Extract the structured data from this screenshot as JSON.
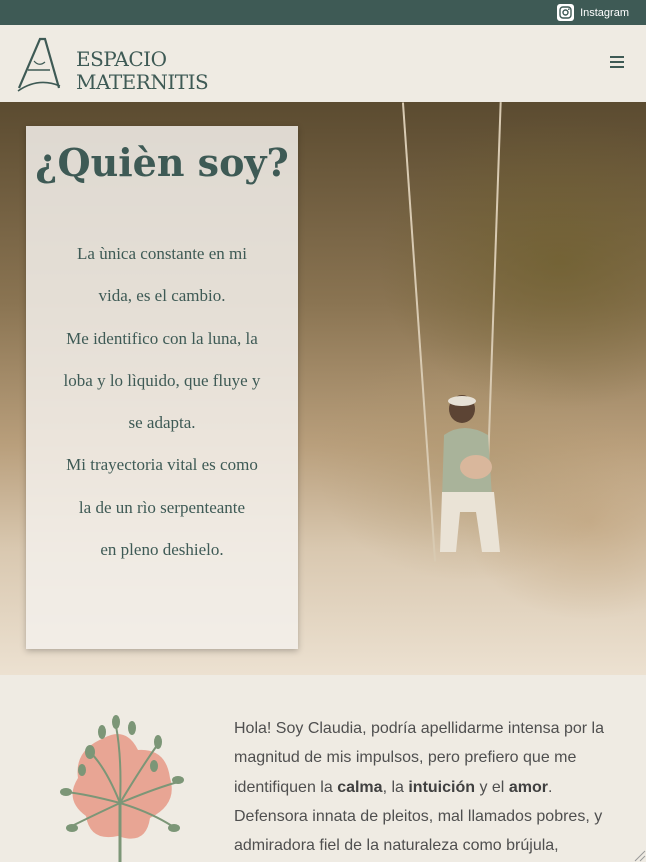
{
  "topbar": {
    "instagram_label": "Instagram",
    "icon": "instagram-icon",
    "bg_color": "#3e5a55"
  },
  "header": {
    "logo_line1": "ESPACIO",
    "logo_line2": "MATERNITIS",
    "menu_icon": "hamburger-menu-icon"
  },
  "hero": {
    "title": "¿Quièn soy?",
    "lines": [
      "La ùnica constante en mi",
      "vida, es el cambio.",
      "Me identifico con la luna, la",
      "loba y lo lìquido, que fluye y",
      "se adapta.",
      "Mi trayectoria vital es como",
      "la de un rìo serpenteante",
      "en pleno deshielo."
    ]
  },
  "about": {
    "flower_icon": "flower-illustration",
    "p1": "Hola! Soy Claudia, podría apellidarme intensa por la magnitud de mis impulsos, pero prefiero que me identifiquen la ",
    "b1": "calma",
    "p2": ", la ",
    "b2": "intuición",
    "p3": " y el ",
    "b3": "amor",
    "p4": ". Defensora innata de pleitos, mal llamados pobres, y admiradora fiel de la naturaleza como brújula,"
  },
  "colors": {
    "accent": "#3e5a55",
    "background": "#efebe3",
    "flower_petal": "#e8a594",
    "flower_stem": "#7c9677"
  }
}
